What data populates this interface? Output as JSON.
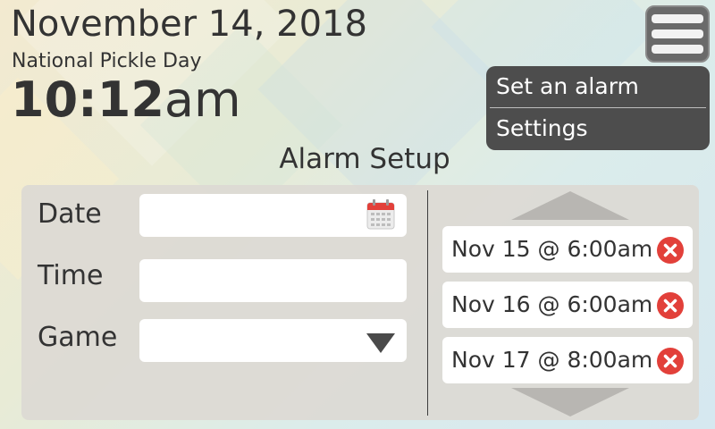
{
  "header": {
    "date": "November 14, 2018",
    "holiday": "National Pickle Day",
    "time_hm": "10:12",
    "time_ampm": "am"
  },
  "menu": {
    "icon": "hamburger-menu-icon",
    "items": [
      {
        "label": "Set an alarm"
      },
      {
        "label": "Settings"
      }
    ]
  },
  "alarm_setup": {
    "title": "Alarm Setup",
    "fields": {
      "date": {
        "label": "Date",
        "value": "",
        "icon": "calendar-icon"
      },
      "time": {
        "label": "Time",
        "value": ""
      },
      "game": {
        "label": "Game",
        "value": "",
        "icon": "chevron-down-icon"
      }
    },
    "alarms": [
      {
        "label": "Nov 15 @ 6:00am"
      },
      {
        "label": "Nov 16 @ 6:00am"
      },
      {
        "label": "Nov 17 @ 8:00am"
      }
    ]
  },
  "colors": {
    "delete": "#e2403a",
    "panel": "#dcd9d4",
    "menu_bg": "#4d4d4d",
    "scroll_arrow": "#b8b6b2",
    "select_arrow": "#4a4a4a"
  }
}
